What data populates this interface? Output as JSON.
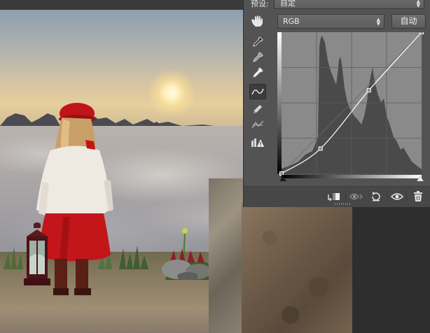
{
  "properties_panel": {
    "preset_label": "预设:",
    "preset_value": "自定",
    "channel_value": "RGB",
    "auto_button_label": "自动",
    "curve_points": [
      {
        "input": 0,
        "output": 0
      },
      {
        "input": 71,
        "output": 45
      },
      {
        "input": 159,
        "output": 150
      },
      {
        "input": 255,
        "output": 255
      }
    ],
    "tools": [
      "targeted-adjust",
      "sample-black-eyedropper",
      "sample-gray-eyedropper",
      "sample-white-eyedropper",
      "edit-points-curve",
      "draw-pencil",
      "smooth-curve",
      "clipping-warning"
    ],
    "bottom_actions": [
      "clip-to-layer",
      "view-previous-state",
      "reset-adjustment",
      "toggle-visibility",
      "delete-layer"
    ]
  },
  "canvas": {
    "subject": "girl-with-red-hat-and-lantern"
  },
  "colors": {
    "panel_bg": "#535353",
    "graph_bg": "#8a8a8a",
    "histogram": "#4a4a4a",
    "curve": "#ffffff"
  }
}
